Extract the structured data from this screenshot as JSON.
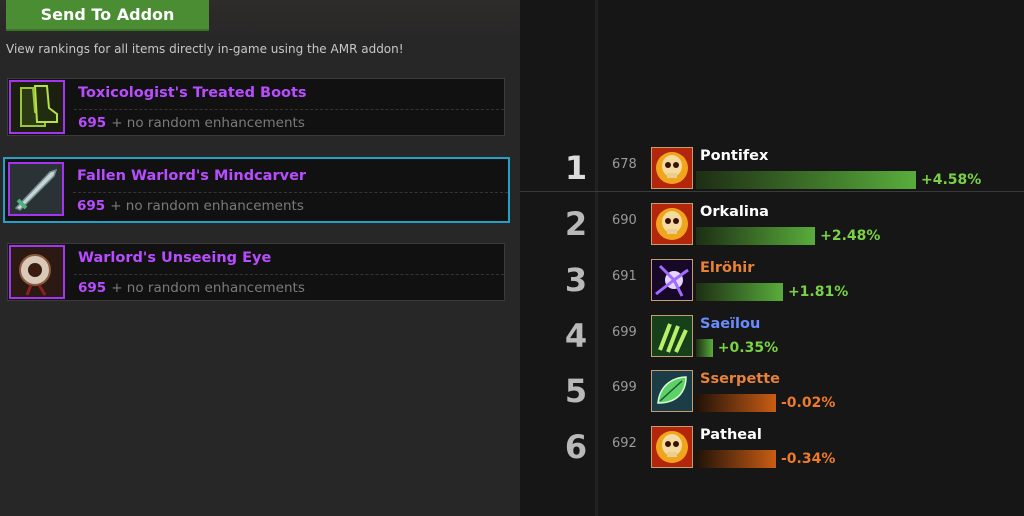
{
  "header": {
    "send_button_label": "Send To Addon",
    "hint_text": "View rankings for all items directly in-game using the AMR addon!"
  },
  "items": [
    {
      "name": "Toxicologist's Treated Boots",
      "ilvl": "695",
      "enhancements": "+ no random enhancements",
      "icon": "boots-icon",
      "selected": false
    },
    {
      "name": "Fallen Warlord's Mindcarver",
      "ilvl": "695",
      "enhancements": "+ no random enhancements",
      "icon": "dagger-icon",
      "selected": true
    },
    {
      "name": "Warlord's Unseeing Eye",
      "ilvl": "695",
      "enhancements": "+ no random enhancements",
      "icon": "eye-icon",
      "selected": false
    }
  ],
  "rankings": [
    {
      "rank": "1",
      "ilvl": "678",
      "name": "Pontifex",
      "name_color": "#ffffff",
      "percent": "+4.58%",
      "value": 4.58,
      "icon": "skull-fire-icon"
    },
    {
      "rank": "2",
      "ilvl": "690",
      "name": "Orkalina",
      "name_color": "#ffffff",
      "percent": "+2.48%",
      "value": 2.48,
      "icon": "skull-fire-icon"
    },
    {
      "rank": "3",
      "ilvl": "691",
      "name": "Elröhir",
      "name_color": "#e8823a",
      "percent": "+1.81%",
      "value": 1.81,
      "icon": "shadow-burst-icon"
    },
    {
      "rank": "4",
      "ilvl": "699",
      "name": "Saeïlou",
      "name_color": "#6a8cff",
      "percent": "+0.35%",
      "value": 0.35,
      "icon": "nature-claw-icon"
    },
    {
      "rank": "5",
      "ilvl": "699",
      "name": "Sserpette",
      "name_color": "#e8823a",
      "percent": "-0.02%",
      "value": -0.02,
      "icon": "leaf-icon"
    },
    {
      "rank": "6",
      "ilvl": "692",
      "name": "Patheal",
      "name_color": "#ffffff",
      "percent": "-0.34%",
      "value": -0.34,
      "icon": "skull-fire-icon"
    }
  ],
  "colors": {
    "accent_green": "#4a8d33",
    "epic_purple": "#b84dff",
    "selected_border": "#25a0c4",
    "positive": "#79d245",
    "negative": "#ee7a2a"
  }
}
